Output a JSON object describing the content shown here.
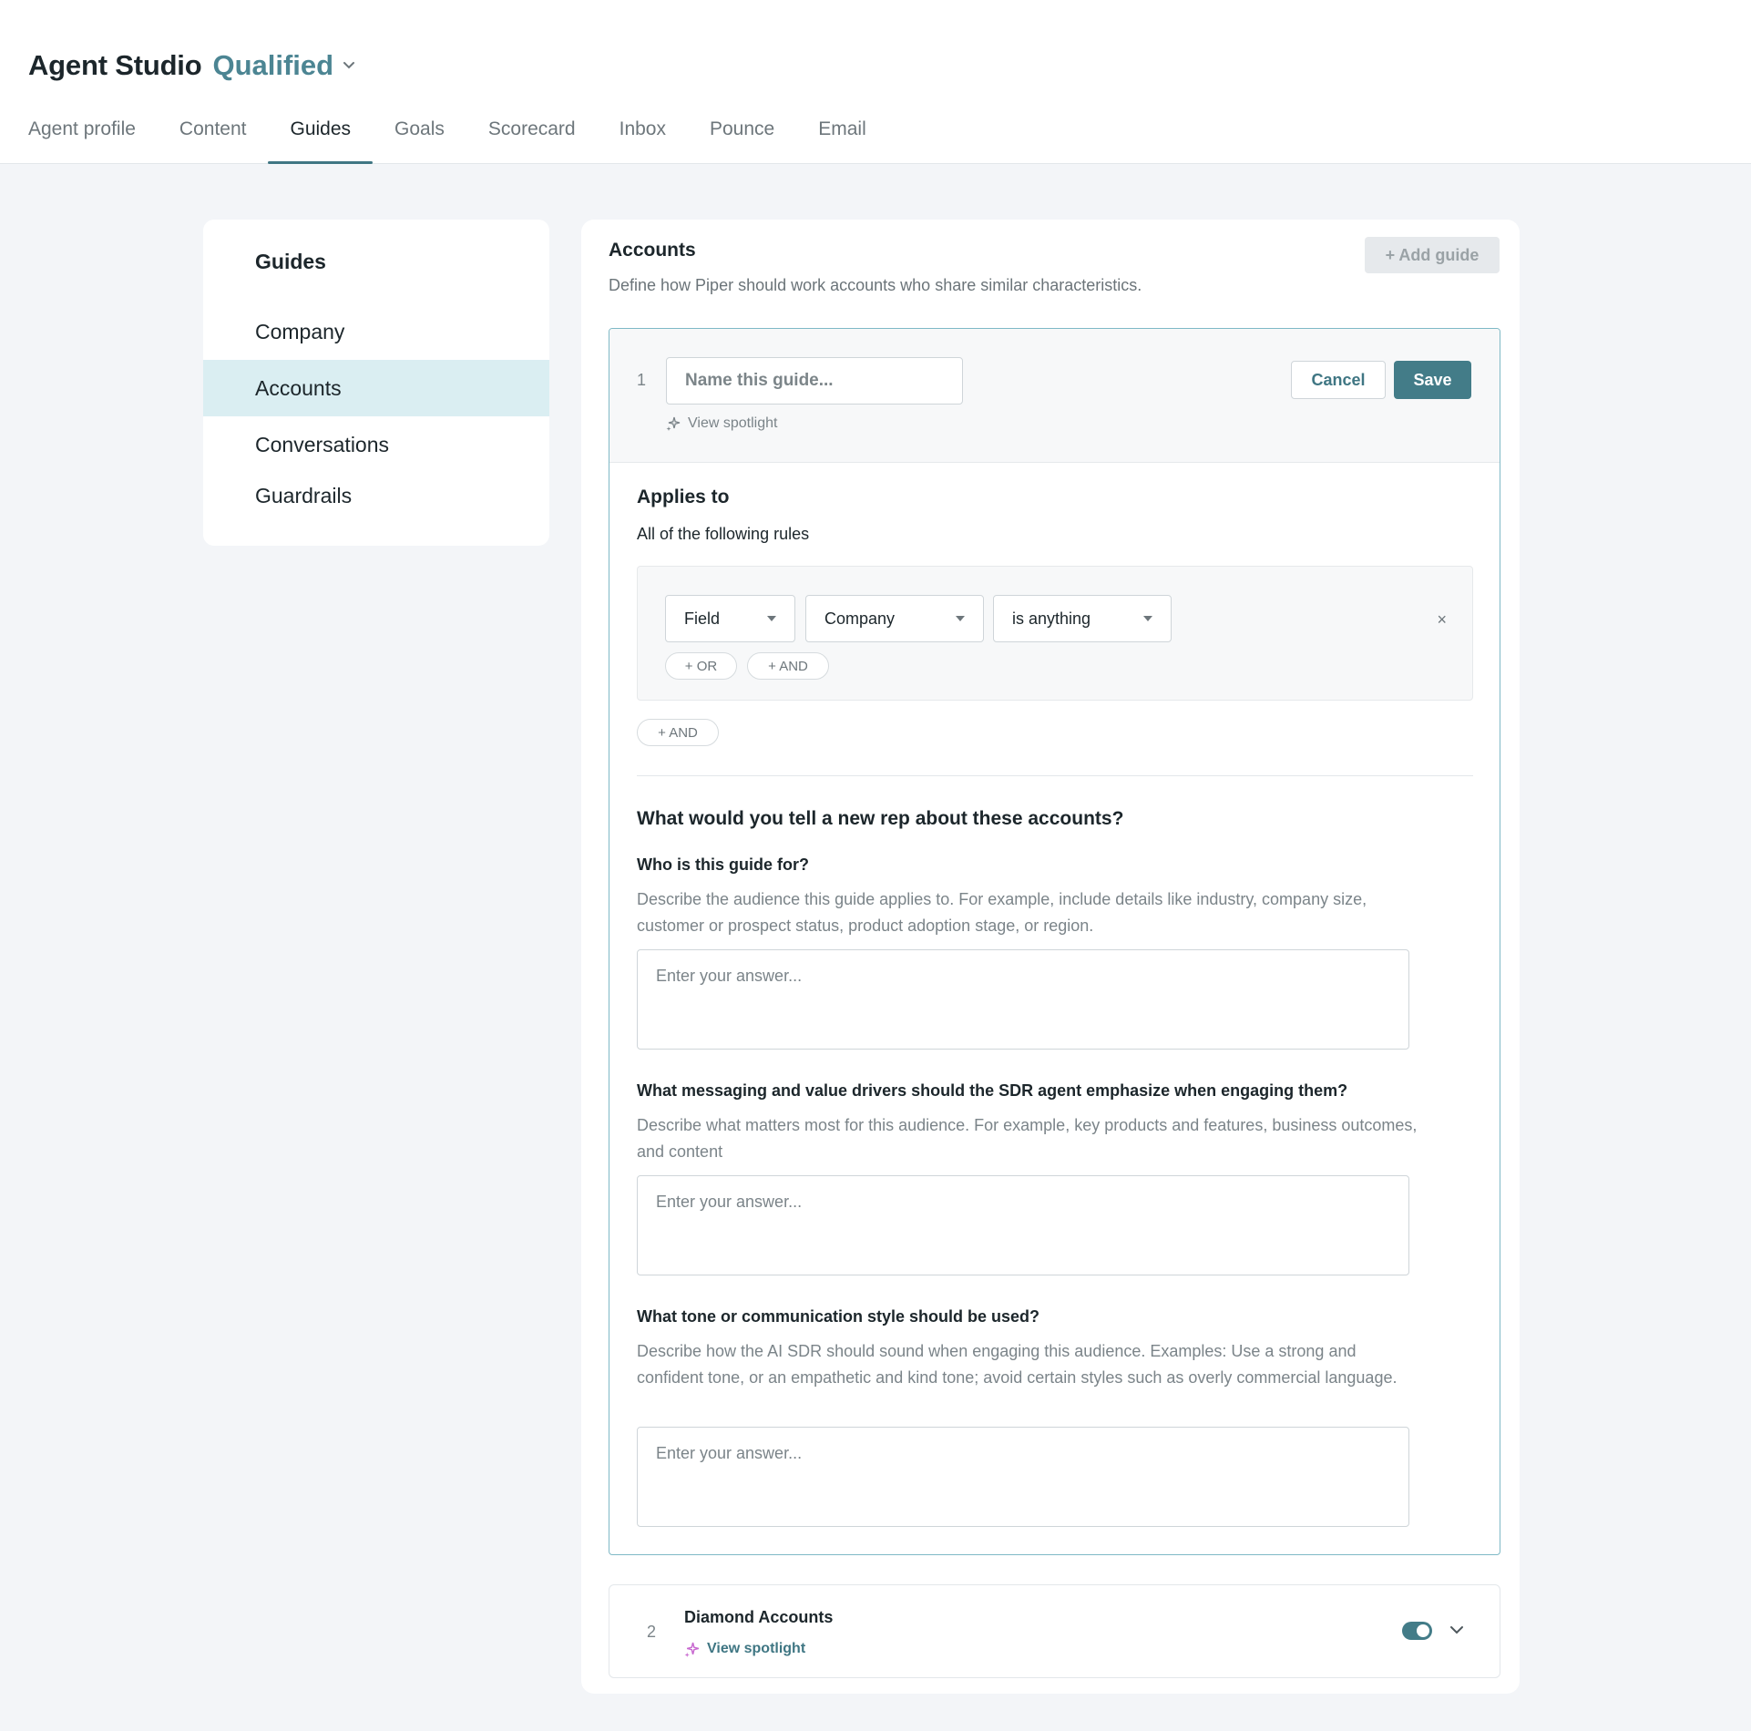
{
  "header": {
    "app_name": "Agent Studio",
    "workspace": "Qualified",
    "tabs": [
      {
        "label": "Agent profile"
      },
      {
        "label": "Content"
      },
      {
        "label": "Guides"
      },
      {
        "label": "Goals"
      },
      {
        "label": "Scorecard"
      },
      {
        "label": "Inbox"
      },
      {
        "label": "Pounce"
      },
      {
        "label": "Email"
      }
    ],
    "active_tab": "Guides"
  },
  "sidebar": {
    "heading": "Guides",
    "items": [
      {
        "label": "Company"
      },
      {
        "label": "Accounts"
      },
      {
        "label": "Conversations"
      },
      {
        "label": "Guardrails"
      }
    ],
    "selected": "Accounts"
  },
  "main": {
    "title": "Accounts",
    "description": "Define how Piper should work accounts who share similar characteristics.",
    "add_guide_label": "+ Add guide",
    "editor": {
      "index": "1",
      "name_placeholder": "Name this guide...",
      "view_spotlight": "View spotlight",
      "cancel_label": "Cancel",
      "save_label": "Save",
      "applies_title": "Applies to",
      "applies_sub": "All of the following rules",
      "rule": {
        "field": "Field",
        "object": "Company",
        "operator": "is anything",
        "close": "×",
        "or_label": "+ OR",
        "and_label": "+ AND"
      },
      "outer_and_label": "+ AND",
      "section_title": "What would you tell a new rep about these accounts?",
      "questions": [
        {
          "label": "Who is this guide for?",
          "description": "Describe the audience this guide applies to. For example, include details like industry, company size, customer or prospect status, product adoption stage, or region.",
          "placeholder": "Enter your answer..."
        },
        {
          "label": "What messaging and value drivers should the SDR agent emphasize when engaging them?",
          "description": "Describe what matters most for this audience. For example, key products and features, business outcomes, and content",
          "placeholder": "Enter your answer..."
        },
        {
          "label": "What tone or communication style should be used?",
          "description": "Describe how the AI SDR should sound when engaging this audience. Examples: Use a strong and confident tone, or an empathetic and kind tone; avoid certain styles such as overly commercial language.",
          "placeholder": "Enter your answer..."
        }
      ]
    },
    "guide_row": {
      "index": "2",
      "name": "Diamond Accounts",
      "view_spotlight": "View spotlight",
      "enabled": true
    }
  },
  "colors": {
    "accent": "#437c88",
    "workspace": "#4c8593",
    "selected_nav": "#daeef2",
    "editor_border": "#7fb9c6",
    "spotlight_icon": "#c86ad0"
  }
}
